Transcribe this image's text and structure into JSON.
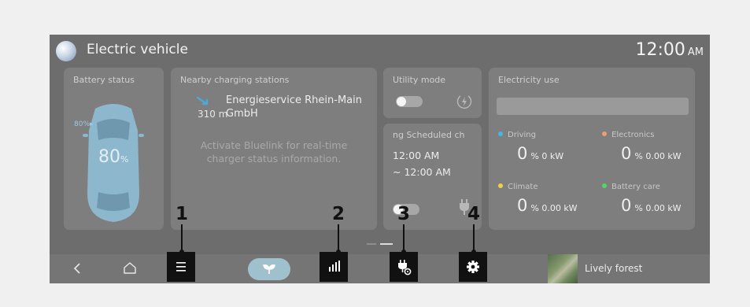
{
  "header": {
    "title": "Electric vehicle",
    "time": "12:00",
    "ampm": "AM"
  },
  "battery": {
    "title": "Battery status",
    "target_mark": "80%▸",
    "level_text": "80",
    "pct_sign": "%",
    "level": 80
  },
  "nearby": {
    "title": "Nearby charging stations",
    "distance": "310 m",
    "station_name": "Energieservice Rhein-Main GmbH",
    "message": "Activate Bluelink for real-time charger status information."
  },
  "utility": {
    "title": "Utility mode"
  },
  "scheduled": {
    "title": "ng  Scheduled ch",
    "time_start": "12:00 AM",
    "time_end": "~ 12:00 AM"
  },
  "electricity": {
    "title": "Electricity use",
    "items": [
      {
        "label": "Driving",
        "color": "#3fb8e6",
        "value": "0",
        "unit": "% 0 kW"
      },
      {
        "label": "Electronics",
        "color": "#f29a7a",
        "value": "0",
        "unit": "% 0.00 kW"
      },
      {
        "label": "Climate",
        "color": "#f2cf4a",
        "value": "0",
        "unit": "% 0.00 kW"
      },
      {
        "label": "Battery care",
        "color": "#4fd66a",
        "value": "0",
        "unit": "% 0.00 kW"
      }
    ]
  },
  "dock": {
    "back_icon": "chevron-left-icon",
    "home_icon": "home-icon",
    "leaf_icon": "leaf-icon",
    "media_label": "Lively forest"
  },
  "callouts": [
    "1",
    "2",
    "3",
    "4"
  ]
}
